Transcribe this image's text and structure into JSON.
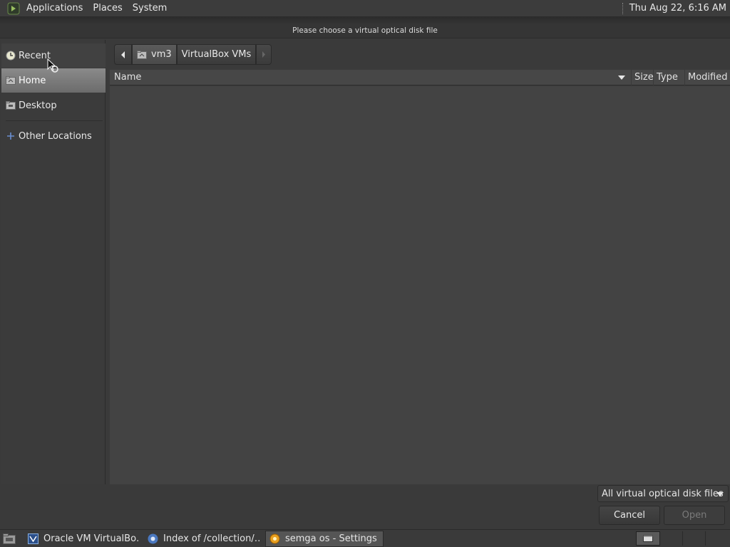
{
  "top_panel": {
    "menus": [
      "Applications",
      "Places",
      "System"
    ],
    "clock": "Thu Aug 22,  6:16 AM"
  },
  "dialog": {
    "title": "Please choose a virtual optical disk file",
    "sidebar": {
      "items": [
        {
          "label": "Recent",
          "icon": "recent-icon"
        },
        {
          "label": "Home",
          "icon": "home-folder-icon"
        },
        {
          "label": "Desktop",
          "icon": "desktop-folder-icon"
        },
        {
          "label": "Other Locations",
          "icon": "plus-icon"
        }
      ]
    },
    "pathbar": {
      "segments": [
        "vm3",
        "VirtualBox VMs"
      ]
    },
    "columns": {
      "name": "Name",
      "size": "Size",
      "type": "Type",
      "modified": "Modified"
    },
    "filter": "All virtual optical disk files",
    "buttons": {
      "cancel": "Cancel",
      "open": "Open"
    }
  },
  "taskbar": {
    "tasks": [
      {
        "label": "Oracle VM VirtualBo…",
        "icon": "virtualbox-icon"
      },
      {
        "label": "Index of /collection/…",
        "icon": "chrome-icon"
      },
      {
        "label": "semga os - Settings",
        "icon": "settings-gear-icon"
      }
    ]
  }
}
